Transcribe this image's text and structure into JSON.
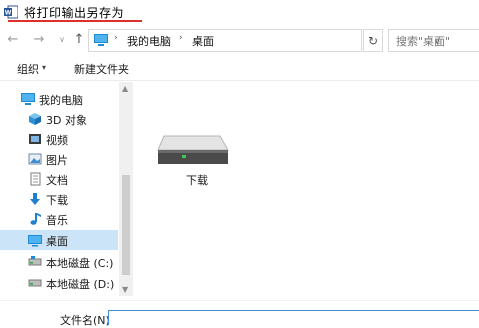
{
  "window": {
    "title": "将打印输出另存为"
  },
  "nav": {
    "back": "←",
    "forward": "→",
    "dropdown": "∨",
    "up": "↑"
  },
  "address": {
    "crumbs": [
      "我的电脑",
      "桌面"
    ],
    "separator": "›",
    "dropdown": "∨",
    "refresh": "↻"
  },
  "search": {
    "placeholder": "搜索\"桌面\""
  },
  "toolbar": {
    "organize": "组织",
    "organize_caret": "▾",
    "new_folder": "新建文件夹"
  },
  "sidebar": {
    "items": [
      {
        "label": "我的电脑",
        "icon": "computer-icon"
      },
      {
        "label": "3D 对象",
        "icon": "3d-objects-icon"
      },
      {
        "label": "视频",
        "icon": "video-icon"
      },
      {
        "label": "图片",
        "icon": "pictures-icon"
      },
      {
        "label": "文档",
        "icon": "documents-icon"
      },
      {
        "label": "下载",
        "icon": "download-icon"
      },
      {
        "label": "音乐",
        "icon": "music-icon"
      },
      {
        "label": "桌面",
        "icon": "desktop-icon",
        "selected": true
      },
      {
        "label": "本地磁盘 (C:)",
        "icon": "drive-icon"
      },
      {
        "label": "本地磁盘 (D:)",
        "icon": "drive-icon"
      }
    ]
  },
  "scrollbar": {
    "up": "▲",
    "down": "▼"
  },
  "main": {
    "items": [
      {
        "label": "下载",
        "icon": "hard-drive-icon"
      }
    ]
  },
  "footer": {
    "filename_label": "文件名(N):",
    "filename_value": ""
  },
  "colors": {
    "selected_bg": "#cce4f7",
    "title_underline": "#e0302a",
    "accent": "#0078d7"
  }
}
